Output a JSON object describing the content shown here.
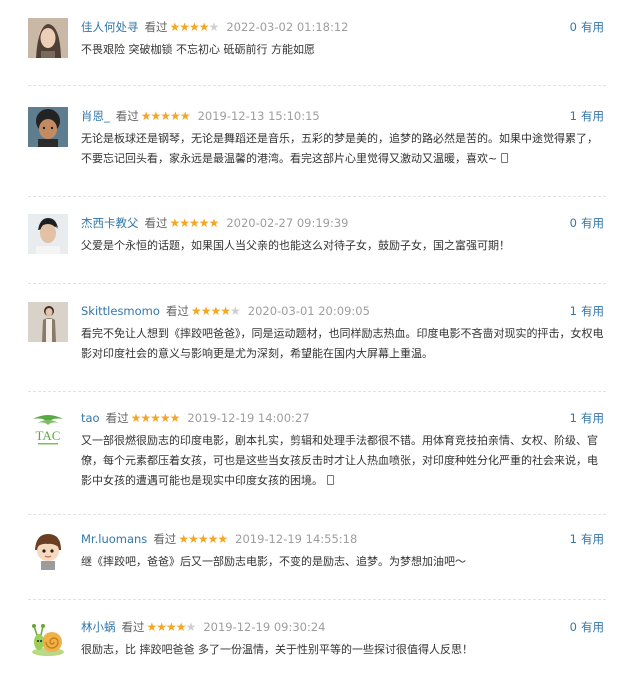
{
  "reviews": [
    {
      "user": "佳人何处寻",
      "action": "看过",
      "rating": 4,
      "time": "2022-03-02 01:18:12",
      "useful_count": "0",
      "useful_label": "有用",
      "content": "不畏艰险 突破枷锁 不忘初心 砥砺前行 方能如愿",
      "mobile": false
    },
    {
      "user": "肖恩_",
      "action": "看过",
      "rating": 5,
      "time": "2019-12-13 15:10:15",
      "useful_count": "1",
      "useful_label": "有用",
      "content": "无论是板球还是钢琴，无论是舞蹈还是音乐，五彩的梦是美的，追梦的路必然是苦的。如果中途觉得累了，不要忘记回头看，家永远是最温馨的港湾。看完这部片心里觉得又激动又温暖，喜欢~",
      "mobile": true
    },
    {
      "user": "杰西卡教父",
      "action": "看过",
      "rating": 5,
      "time": "2020-02-27 09:19:39",
      "useful_count": "0",
      "useful_label": "有用",
      "content": "父爱是个永恒的话题，如果国人当父亲的也能这么对待子女，鼓励子女，国之富强可期！",
      "mobile": false
    },
    {
      "user": "Skittlesmomo",
      "action": "看过",
      "rating": 4,
      "time": "2020-03-01 20:09:05",
      "useful_count": "1",
      "useful_label": "有用",
      "content": "看完不免让人想到《摔跤吧爸爸》，同是运动题材，也同样励志热血。印度电影不吝啬对现实的抨击，女权电影对印度社会的意义与影响更是尤为深刻，希望能在国内大屏幕上重温。",
      "mobile": false
    },
    {
      "user": "tao",
      "action": "看过",
      "rating": 5,
      "time": "2019-12-19 14:00:27",
      "useful_count": "1",
      "useful_label": "有用",
      "content": "又一部很燃很励志的印度电影，剧本扎实，剪辑和处理手法都很不错。用体育竞技拍亲情、女权、阶级、官僚，每个元素都压着女孩，可也是这些当女孩反击时才让人热血喷张，对印度种姓分化严重的社会来说，电影中女孩的遭遇可能也是现实中印度女孩的困境。",
      "mobile": true
    },
    {
      "user": "Mr.luomans",
      "action": "看过",
      "rating": 5,
      "time": "2019-12-19 14:55:18",
      "useful_count": "1",
      "useful_label": "有用",
      "content": "继《摔跤吧，爸爸》后又一部励志电影，不变的是励志、追梦。为梦想加油吧～",
      "mobile": false
    },
    {
      "user": "林小蜗",
      "action": "看过",
      "rating": 4,
      "time": "2019-12-19 09:30:24",
      "useful_count": "0",
      "useful_label": "有用",
      "content": "很励志，比 摔跤吧爸爸 多了一份温情，关于性别平等的一些探讨很值得人反思！",
      "mobile": false
    }
  ],
  "colors": {
    "link": "#3377aa",
    "star": "#f5a623",
    "star_empty": "#cfcfcf",
    "time": "#9e9e9e",
    "text": "#333333"
  },
  "avatar_icons": [
    "woman-portrait-avatar",
    "curly-hair-man-avatar",
    "young-man-avatar",
    "woman-standing-avatar",
    "tao-logo-avatar",
    "cartoon-boy-avatar",
    "cartoon-snail-avatar"
  ]
}
